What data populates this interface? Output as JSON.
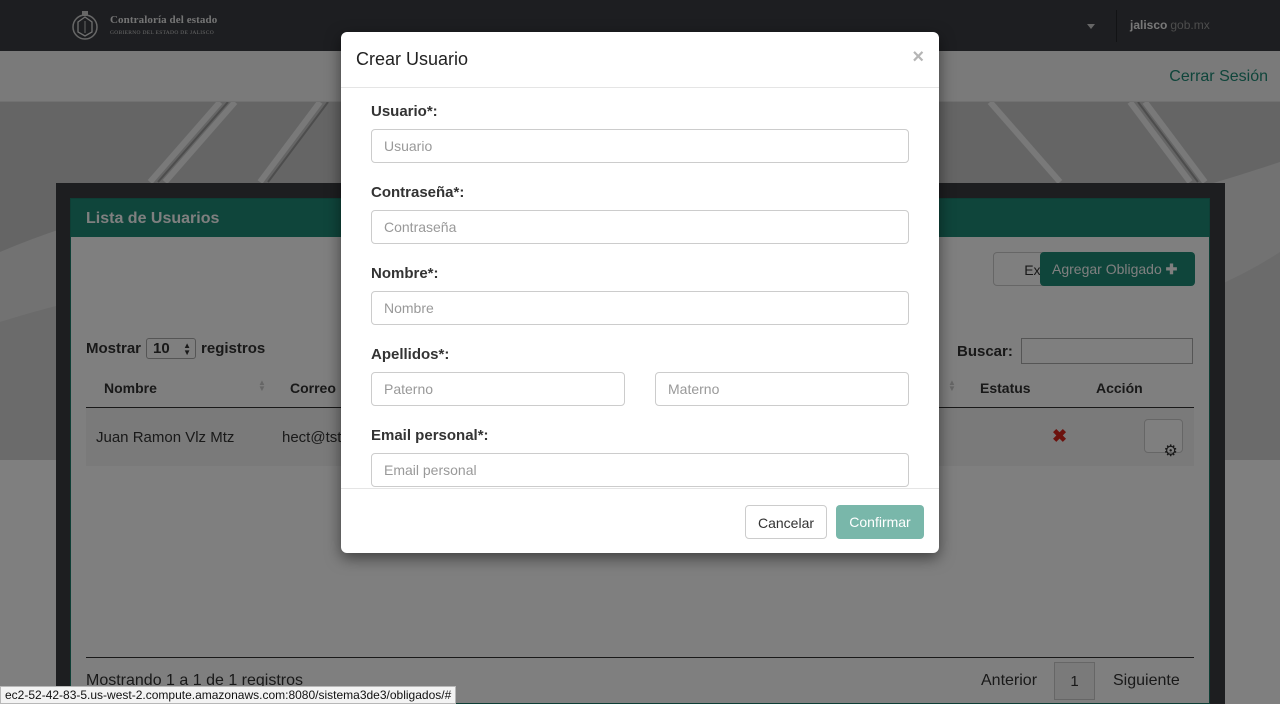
{
  "header": {
    "org_title": "Contraloría del estado",
    "org_subtitle": "GOBIERNO DEL ESTADO DE JALISCO",
    "brand_name": "jalisco",
    "brand_domain": "gob.mx"
  },
  "subheader": {
    "logout_label": "Cerrar Sesión"
  },
  "panel": {
    "title": "Lista de Usuarios",
    "export_label": "Exportar",
    "add_label": "Agregar Obligado",
    "show_prefix": "Mostrar",
    "page_size": "10",
    "show_suffix": "registros",
    "search_label": "Buscar:",
    "columns": {
      "name": "Nombre",
      "email": "Correo",
      "status": "Estatus",
      "action": "Acción"
    },
    "rows": [
      {
        "name": "Juan Ramon Vlz Mtz",
        "email": "hect@tst"
      }
    ],
    "info": "Mostrando 1 a 1 de 1 registros",
    "prev_label": "Anterior",
    "page_current": "1",
    "next_label": "Siguiente"
  },
  "status_url": "ec2-52-42-83-5.us-west-2.compute.amazonaws.com:8080/sistema3de3/obligados/#",
  "modal": {
    "title": "Crear Usuario",
    "close_glyph": "×",
    "fields": {
      "usuario": {
        "label": "Usuario*:",
        "placeholder": "Usuario"
      },
      "contrasena": {
        "label": "Contraseña*:",
        "placeholder": "Contraseña"
      },
      "nombre": {
        "label": "Nombre*:",
        "placeholder": "Nombre"
      },
      "apellidos": {
        "label": "Apellidos*:",
        "placeholder_paterno": "Paterno",
        "placeholder_materno": "Materno"
      },
      "email": {
        "label": "Email personal*:",
        "placeholder": "Email personal"
      }
    },
    "cancel_label": "Cancelar",
    "confirm_label": "Confirmar"
  },
  "colors": {
    "accent": "#1f8b76",
    "confirm_disabled": "#79b7aa",
    "topbar": "#3a3d42",
    "danger": "#d9241b"
  },
  "icons": {
    "add": "plus-icon",
    "delete": "close-x-icon",
    "settings": "gear-icon",
    "sort": "sort-arrows-icon",
    "menu": "caret-down-icon"
  }
}
